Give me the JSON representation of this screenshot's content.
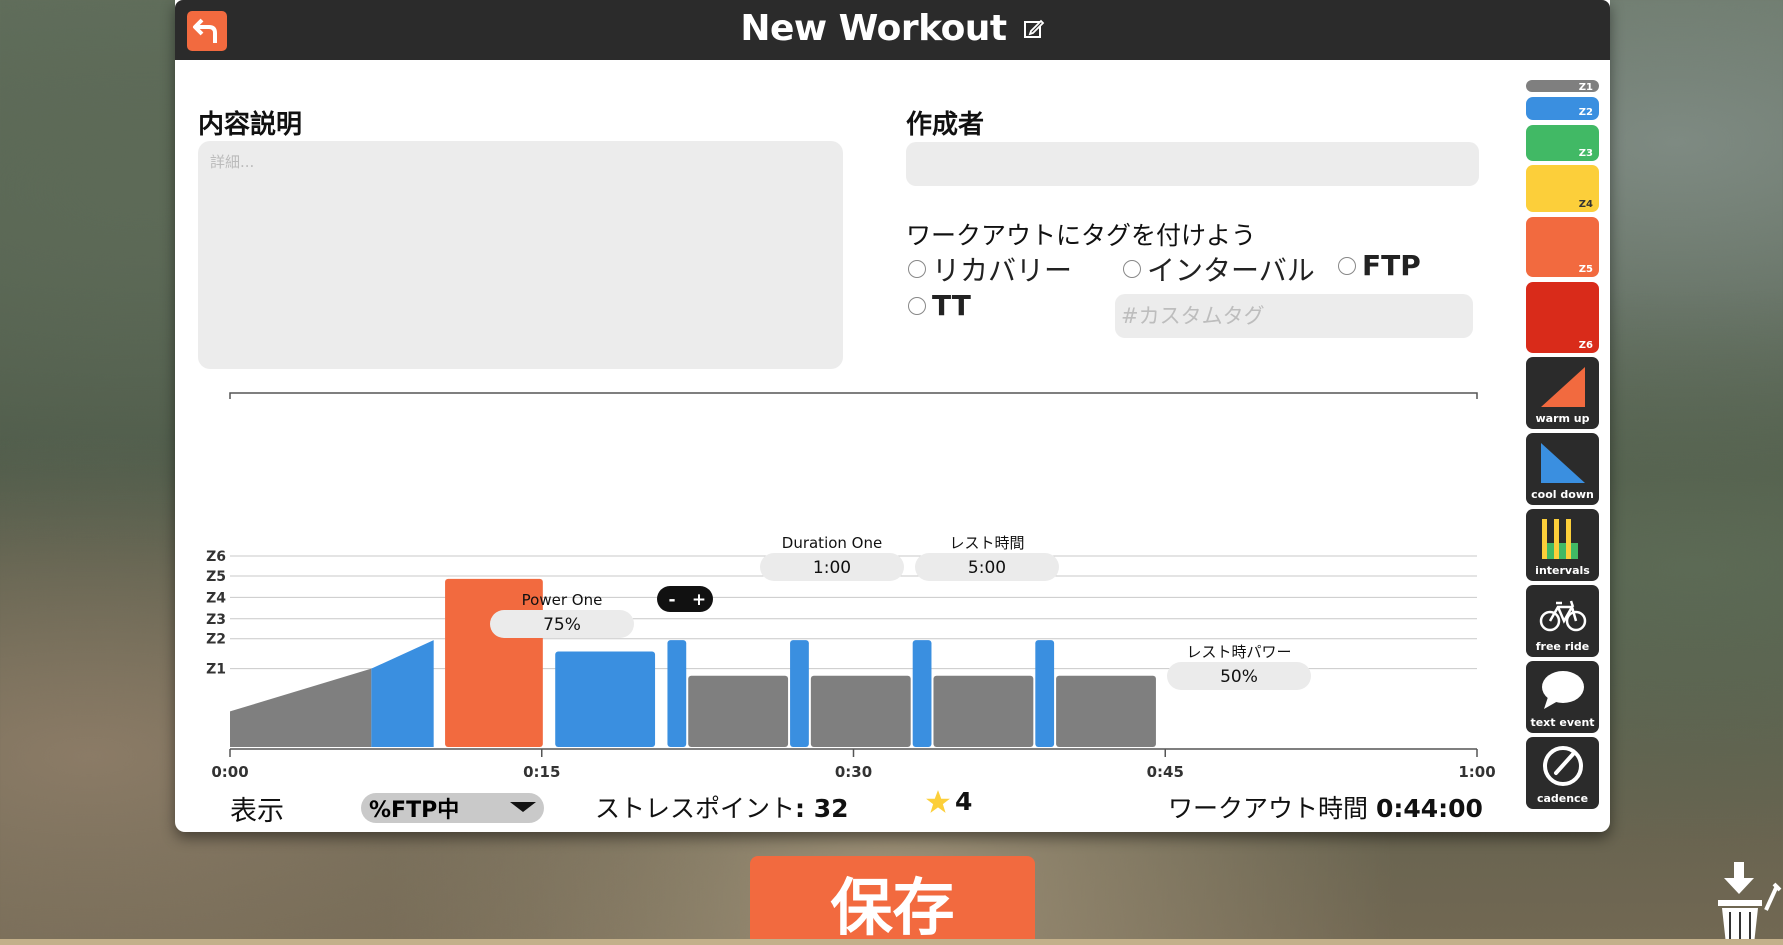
{
  "header": {
    "title": "New Workout"
  },
  "form": {
    "description_label": "内容説明",
    "description_placeholder": "詳細...",
    "author_label": "作成者",
    "author_value": "",
    "tags_label": "ワークアウトにタグを付けよう",
    "tags": [
      {
        "label": "リカバリー",
        "bold": false
      },
      {
        "label": "インターバル",
        "bold": false
      },
      {
        "label": "FTP",
        "bold": true
      },
      {
        "label": "TT",
        "bold": true
      }
    ],
    "custom_tag_placeholder": "#カスタムタグ"
  },
  "zones": [
    {
      "label": "Z1",
      "color": "#7f7f7f"
    },
    {
      "label": "Z2",
      "color": "#3a8fe0"
    },
    {
      "label": "Z3",
      "color": "#41b965"
    },
    {
      "label": "Z4",
      "color": "#fccf3a"
    },
    {
      "label": "Z5",
      "color": "#f26a3f"
    },
    {
      "label": "Z6",
      "color": "#d92b1a"
    }
  ],
  "tools": [
    {
      "label": "warm up",
      "icon": "warmup-ramp-icon"
    },
    {
      "label": "cool down",
      "icon": "cooldown-ramp-icon"
    },
    {
      "label": "intervals",
      "icon": "intervals-bars-icon"
    },
    {
      "label": "free ride",
      "icon": "bicycle-icon"
    },
    {
      "label": "text event",
      "icon": "speech-bubble-icon"
    },
    {
      "label": "cadence",
      "icon": "cadence-gauge-icon"
    }
  ],
  "chart_data": {
    "type": "bar",
    "x_unit": "minutes",
    "xlim": [
      0,
      60
    ],
    "x_ticks": [
      "0:00",
      "0:15",
      "0:30",
      "0:45",
      "1:00"
    ],
    "zone_labels": [
      "Z1",
      "Z2",
      "Z3",
      "Z4",
      "Z5",
      "Z6"
    ],
    "segments": [
      {
        "type": "ramp",
        "start": 0,
        "end": 6.8,
        "from": 25,
        "to": 55,
        "zone": "Z1"
      },
      {
        "type": "ramp",
        "start": 6.8,
        "end": 9.8,
        "from": 55,
        "to": 75,
        "zone": "Z2"
      },
      {
        "type": "steady",
        "start": 10.3,
        "end": 15.1,
        "power": 118,
        "zone": "Z5"
      },
      {
        "type": "steady",
        "start": 15.6,
        "end": 20.5,
        "power": 67,
        "zone": "Z2"
      },
      {
        "type": "steady",
        "start": 21,
        "end": 22,
        "power": 75,
        "zone": "Z2"
      },
      {
        "type": "steady",
        "start": 22,
        "end": 26.9,
        "power": 50,
        "zone": "Z1"
      },
      {
        "type": "steady",
        "start": 26.9,
        "end": 27.9,
        "power": 75,
        "zone": "Z2"
      },
      {
        "type": "steady",
        "start": 27.9,
        "end": 32.8,
        "power": 50,
        "zone": "Z1"
      },
      {
        "type": "steady",
        "start": 32.8,
        "end": 33.8,
        "power": 75,
        "zone": "Z2"
      },
      {
        "type": "steady",
        "start": 33.8,
        "end": 38.7,
        "power": 50,
        "zone": "Z1"
      },
      {
        "type": "steady",
        "start": 38.7,
        "end": 39.7,
        "power": 75,
        "zone": "Z2"
      },
      {
        "type": "steady",
        "start": 39.7,
        "end": 44.6,
        "power": 50,
        "zone": "Z1"
      }
    ],
    "interval_editor": {
      "duration_one_label": "Duration One",
      "duration_one_value": "1:00",
      "rest_time_label": "レスト時間",
      "rest_time_value": "5:00",
      "power_one_label": "Power One",
      "power_one_value": "75%",
      "rest_power_label": "レスト時パワー",
      "rest_power_value": "50%",
      "minus_label": "-",
      "plus_label": "+"
    }
  },
  "footer": {
    "view_label": "表示",
    "view_select": "%FTP中",
    "stress_label": "ストレスポイント",
    "stress_value": ": 32",
    "stars": "4",
    "duration_label": "ワークアウト時間",
    "duration_value": "0:44:00"
  },
  "save_label": "保存"
}
